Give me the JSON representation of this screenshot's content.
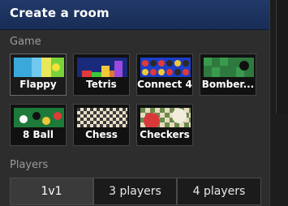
{
  "dialog": {
    "title": "Create a room"
  },
  "game_section": {
    "label": "Game"
  },
  "games": [
    {
      "label": "Flappy",
      "icon": "flappy-icon",
      "selected": true
    },
    {
      "label": "Tetris",
      "icon": "tetris-icon",
      "selected": false
    },
    {
      "label": "Connect 4",
      "icon": "connect-four-icon",
      "selected": false
    },
    {
      "label": "Bomber...",
      "icon": "bomber-icon",
      "selected": false
    },
    {
      "label": "8 Ball",
      "icon": "eight-ball-icon",
      "selected": false
    },
    {
      "label": "Chess",
      "icon": "chess-icon",
      "selected": false
    },
    {
      "label": "Checkers",
      "icon": "checkers-icon",
      "selected": false
    }
  ],
  "players_section": {
    "label": "Players"
  },
  "player_options": [
    {
      "label": "1v1",
      "selected": true
    },
    {
      "label": "3 players",
      "selected": false
    },
    {
      "label": "4 players",
      "selected": false
    }
  ],
  "colors": {
    "title_bar": "#1f3563",
    "panel": "#2d2d2d",
    "tile_bg": "#111111"
  }
}
